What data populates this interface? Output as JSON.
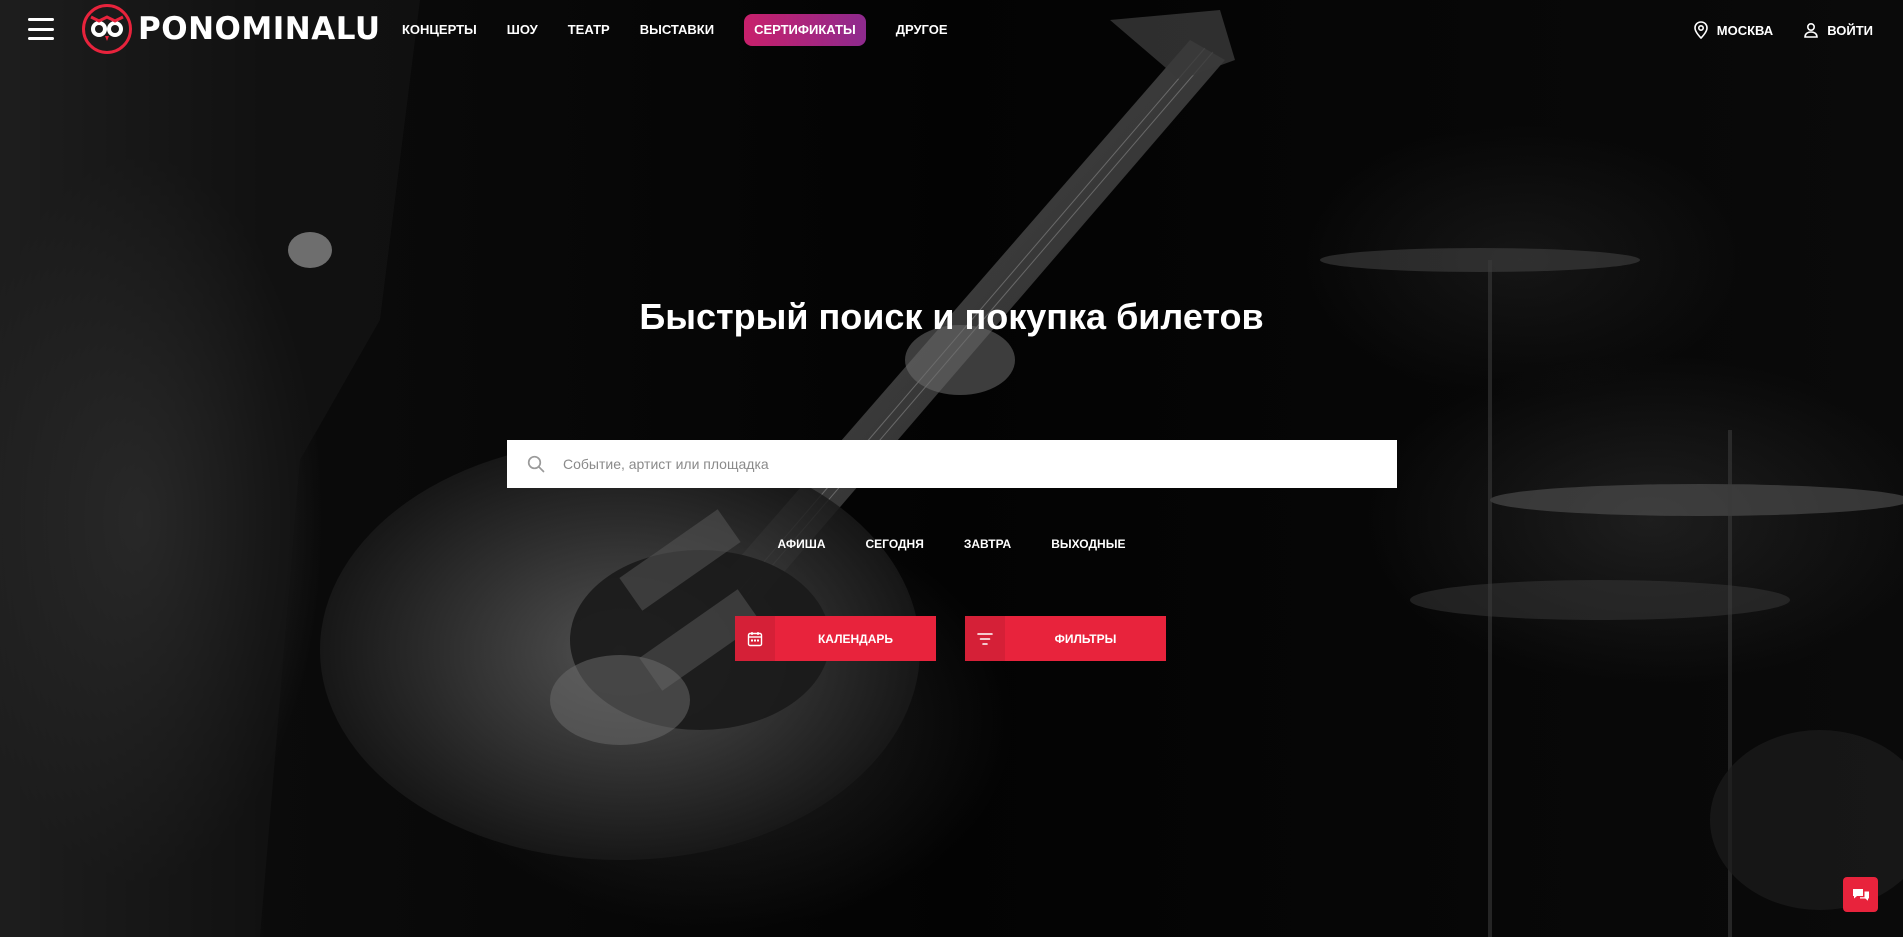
{
  "header": {
    "logo_text": "PONOMINALU",
    "nav": [
      {
        "label": "КОНЦЕРТЫ"
      },
      {
        "label": "ШОУ"
      },
      {
        "label": "ТЕАТР"
      },
      {
        "label": "ВЫСТАВКИ"
      },
      {
        "label": "СЕРТИФИКАТЫ"
      },
      {
        "label": "ДРУГОЕ"
      }
    ],
    "city_label": "МОСКВА",
    "login_label": "ВОЙТИ"
  },
  "hero": {
    "title": "Быстрый поиск и покупка билетов",
    "search_placeholder": "Событие, артист или площадка",
    "search_value": "",
    "quick_links": [
      {
        "label": "АФИША"
      },
      {
        "label": "СЕГОДНЯ"
      },
      {
        "label": "ЗАВТРА"
      },
      {
        "label": "ВЫХОДНЫЕ"
      }
    ],
    "calendar_label": "КАЛЕНДАРЬ",
    "filters_label": "ФИЛЬТРЫ"
  },
  "icons": {
    "menu": "hamburger-icon",
    "logo": "owl-logo-icon",
    "location": "map-pin-icon",
    "user": "user-icon",
    "search": "search-icon",
    "calendar": "calendar-icon",
    "filters": "filter-lines-icon",
    "chat": "chat-bubbles-icon"
  },
  "colors": {
    "accent": "#e8233c",
    "highlight_gradient_start": "#c8206b",
    "highlight_gradient_end": "#8e2a8e",
    "background": "#000000"
  }
}
